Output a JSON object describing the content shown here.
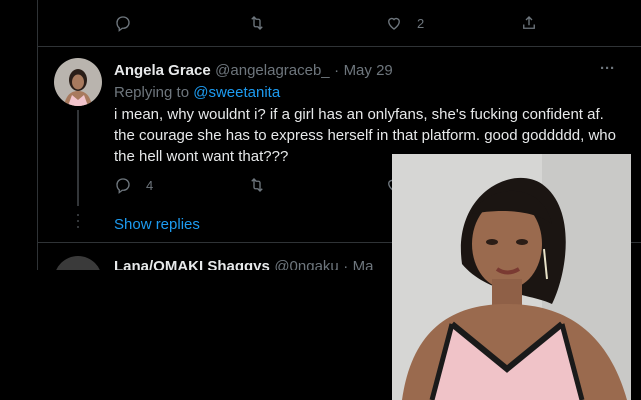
{
  "top_tweet": {
    "reply_count": "",
    "retweet_count": "",
    "like_count": "2",
    "share_count": ""
  },
  "tweet": {
    "author_name": "Angela Grace",
    "handle": "@angelagraceb_",
    "dot": "·",
    "date": "May 29",
    "more": "···",
    "replying_prefix": "Replying to",
    "replying_to": "@sweetanita",
    "text_line1": "i mean, why wouldnt i? if a girl has an onlyfans, she's fucking confident af.",
    "text_line2": "the courage she has to express herself in that platform. good goddddd, who",
    "text_line3": "the hell wont want that???",
    "reply_count": "4",
    "show_replies": "Show replies"
  },
  "next_tweet": {
    "author_name": "Lana/OMAKI Shaggys",
    "handle": "@0ngaku",
    "dot": "·",
    "date_partial": "Ma"
  },
  "colors": {
    "background": "#000000",
    "text": "#d9d9d9",
    "muted": "#6e767d",
    "link": "#1d9bf0"
  }
}
